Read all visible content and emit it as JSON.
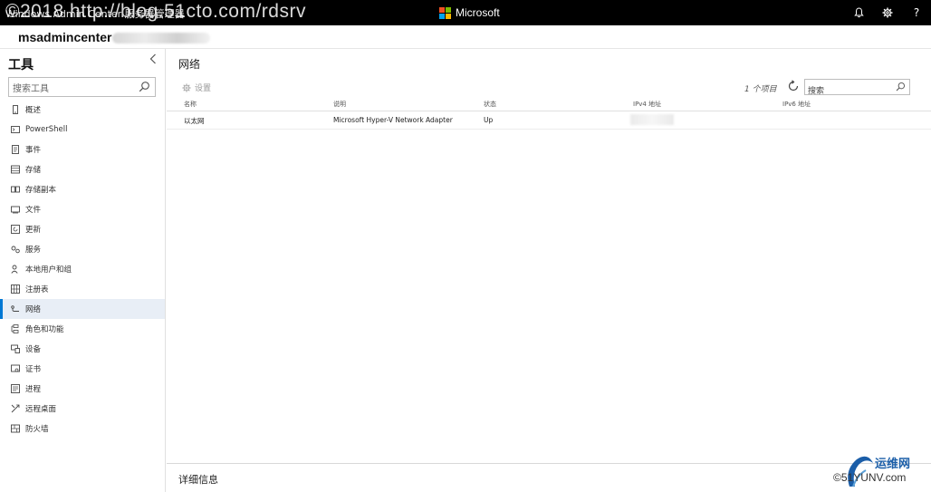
{
  "topbar": {
    "app_title": "Windows Admin Center   服务器管理器",
    "watermark": "©2018 http://blog.51cto.com/rdsrv",
    "brand": "Microsoft",
    "icons": [
      "bell-icon",
      "gear-icon",
      "help-icon"
    ],
    "help_glyph": "?"
  },
  "server": {
    "name": "msadmincenter"
  },
  "sidebar": {
    "title": "工具",
    "search_placeholder": "搜索工具",
    "items": [
      {
        "label": "概述",
        "icon": "overview-icon"
      },
      {
        "label": "PowerShell",
        "icon": "powershell-icon"
      },
      {
        "label": "事件",
        "icon": "events-icon"
      },
      {
        "label": "存储",
        "icon": "storage-icon"
      },
      {
        "label": "存储副本",
        "icon": "storage-replica-icon"
      },
      {
        "label": "文件",
        "icon": "files-icon"
      },
      {
        "label": "更新",
        "icon": "updates-icon"
      },
      {
        "label": "服务",
        "icon": "services-icon"
      },
      {
        "label": "本地用户和组",
        "icon": "users-icon"
      },
      {
        "label": "注册表",
        "icon": "registry-icon"
      },
      {
        "label": "网络",
        "icon": "network-icon",
        "active": true
      },
      {
        "label": "角色和功能",
        "icon": "roles-icon"
      },
      {
        "label": "设备",
        "icon": "devices-icon"
      },
      {
        "label": "证书",
        "icon": "certificates-icon"
      },
      {
        "label": "进程",
        "icon": "processes-icon"
      },
      {
        "label": "远程桌面",
        "icon": "remote-desktop-icon"
      },
      {
        "label": "防火墙",
        "icon": "firewall-icon"
      }
    ]
  },
  "main": {
    "title": "网络",
    "settings_label": "设置",
    "count_text": "1 个项目",
    "search_placeholder": "搜索",
    "columns": [
      "名称",
      "说明",
      "状态",
      "IPv4 地址",
      "IPv6 地址"
    ],
    "rows": [
      {
        "name": "以太网",
        "description": "Microsoft Hyper-V Network Adapter",
        "status": "Up",
        "ipv4": "",
        "ipv6": ""
      }
    ],
    "details_title": "详细信息"
  },
  "watermark_logo": {
    "text": "运维网",
    "url": "©51YUNV.com"
  },
  "colors": {
    "accent": "#0078d4",
    "topbar": "#000000",
    "active_bg": "#e8eef6"
  }
}
